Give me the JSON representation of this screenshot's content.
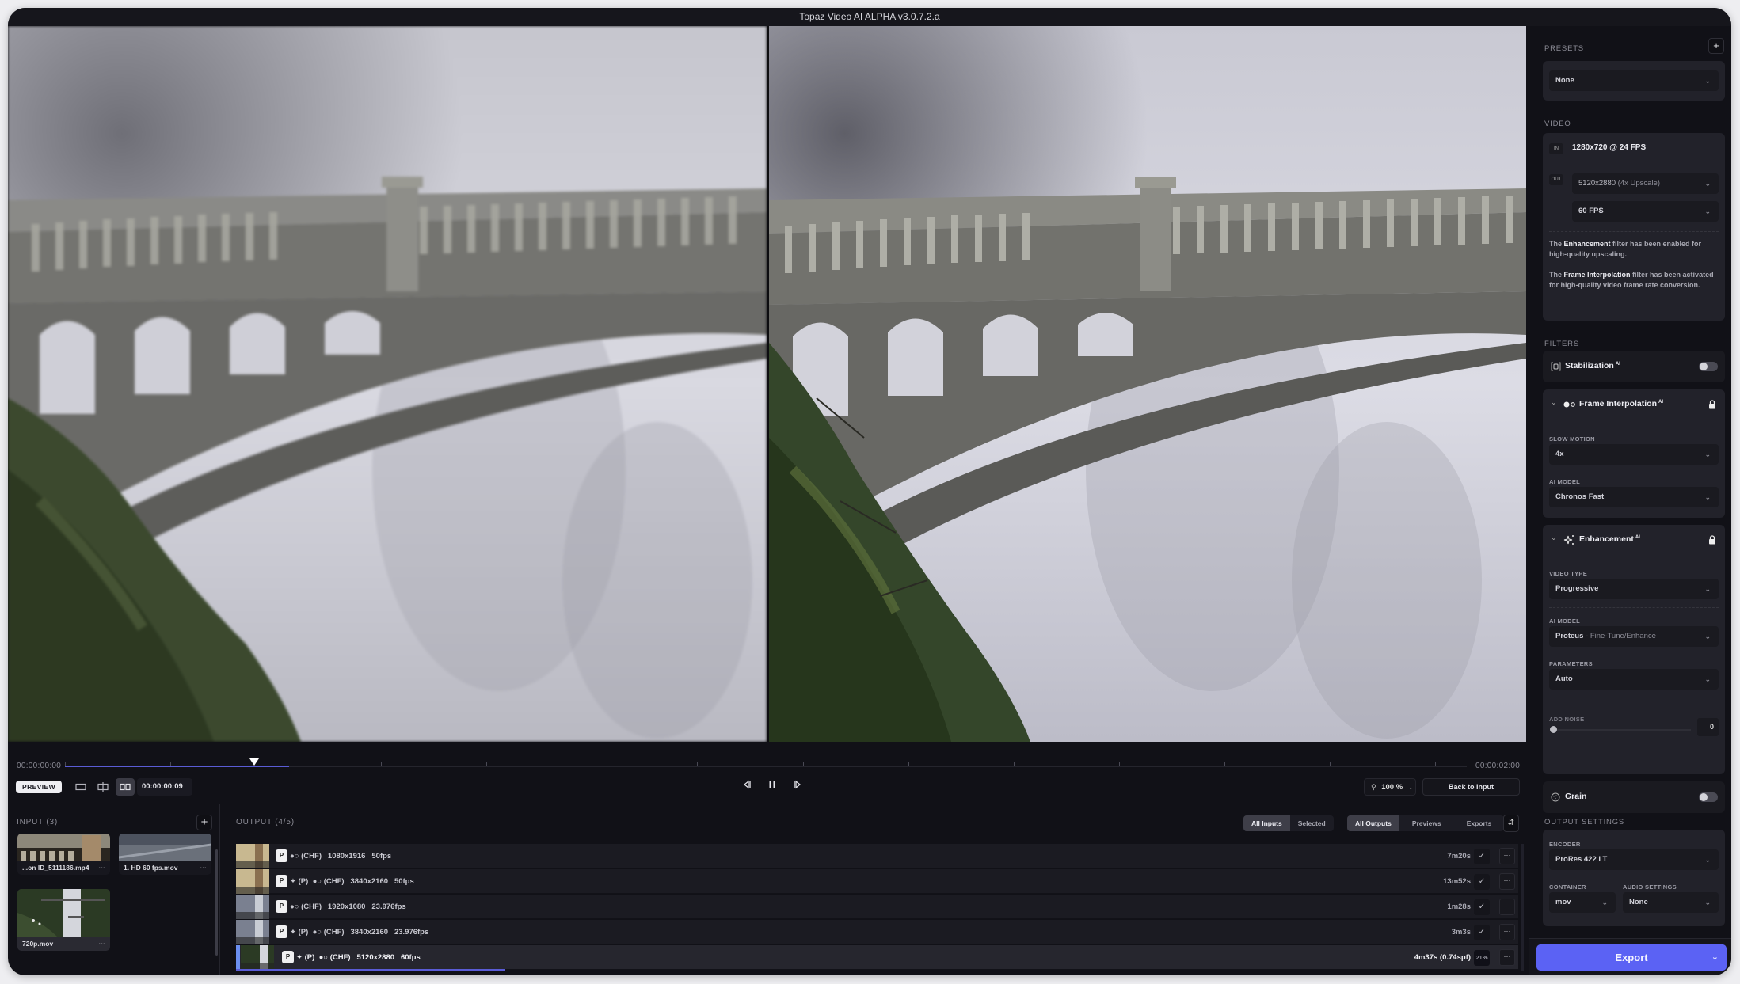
{
  "window": {
    "title": "Topaz Video AI ALPHA  v3.0.7.2.a"
  },
  "timeline": {
    "start_timecode": "00:00:00:00",
    "end_timecode": "00:00:02:00",
    "playhead_fraction": 0.135,
    "processed_fraction": 0.16
  },
  "controls": {
    "preview_label": "PREVIEW",
    "view_modes": [
      "single-view",
      "split-view",
      "side-by-side"
    ],
    "active_view_mode": "side-by-side",
    "current_timecode": "00:00:00:09",
    "zoom_level": "100 %",
    "back_to_input_label": "Back to Input"
  },
  "input": {
    "title": "INPUT (3)",
    "items": [
      {
        "name": "...on ID_5111186.mp4",
        "more": "···"
      },
      {
        "name": "1. HD 60 fps.mov",
        "more": "···"
      },
      {
        "name": "720p.mov",
        "more": "···",
        "selected": true
      }
    ]
  },
  "output": {
    "title": "OUTPUT (4/5)",
    "input_filters": [
      "All Inputs",
      "Selected"
    ],
    "active_input_filter": "All Inputs",
    "output_filters": [
      "All Outputs",
      "Previews",
      "Exports"
    ],
    "active_output_filter": "All Outputs",
    "rows": [
      {
        "badge": "P",
        "enhance": "",
        "interp": "(CHF)",
        "resolution": "1080x1916",
        "fps": "50fps",
        "time": "7m20s",
        "status": "✓"
      },
      {
        "badge": "P",
        "enhance": "(P)",
        "interp": "(CHF)",
        "resolution": "3840x2160",
        "fps": "50fps",
        "time": "13m52s",
        "status": "✓"
      },
      {
        "badge": "P",
        "enhance": "",
        "interp": "(CHF)",
        "resolution": "1920x1080",
        "fps": "23.976fps",
        "time": "1m28s",
        "status": "✓"
      },
      {
        "badge": "P",
        "enhance": "(P)",
        "interp": "(CHF)",
        "resolution": "3840x2160",
        "fps": "23.976fps",
        "time": "3m3s",
        "status": "✓"
      },
      {
        "badge": "P",
        "enhance": "(P)",
        "interp": "(CHF)",
        "resolution": "5120x2880",
        "fps": "60fps",
        "time": "4m37s (0.74spf)",
        "status": "21%",
        "progress": 0.21,
        "active": true
      }
    ]
  },
  "sidebar": {
    "presets": {
      "label": "PRESETS",
      "value": "None"
    },
    "video": {
      "label": "VIDEO",
      "in_tag": "IN",
      "in_value": "1280x720 @ 24 FPS",
      "out_tag": "OUT",
      "out_resolution": "5120x2880",
      "out_resolution_note": "(4x Upscale)",
      "out_fps": "60 FPS",
      "note1_pre": "The ",
      "note1_bold": "Enhancement",
      "note1_post": " filter has been enabled for high-quality upscaling.",
      "note2_pre": "The ",
      "note2_bold": "Frame Interpolation",
      "note2_post": " filter has been activated for high-quality video frame rate conversion."
    },
    "filters": {
      "label": "FILTERS",
      "stabilization": {
        "title": "Stabilization",
        "ai": "AI",
        "enabled": false
      },
      "frame_interpolation": {
        "title": "Frame Interpolation",
        "ai": "AI",
        "slow_motion_label": "SLOW MOTION",
        "slow_motion": "4x",
        "model_label": "AI MODEL",
        "model": "Chronos Fast"
      },
      "enhancement": {
        "title": "Enhancement",
        "ai": "AI",
        "video_type_label": "VIDEO TYPE",
        "video_type": "Progressive",
        "model_label": "AI MODEL",
        "model": "Proteus",
        "model_note": "- Fine-Tune/Enhance",
        "parameters_label": "PARAMETERS",
        "parameters": "Auto",
        "add_noise_label": "ADD NOISE",
        "add_noise": "0"
      },
      "grain": {
        "title": "Grain",
        "enabled": false
      }
    },
    "output_settings": {
      "label": "OUTPUT SETTINGS",
      "encoder_label": "ENCODER",
      "encoder": "ProRes 422 LT",
      "container_label": "CONTAINER",
      "container": "mov",
      "audio_label": "AUDIO SETTINGS",
      "audio": "None"
    },
    "export_label": "Export"
  }
}
